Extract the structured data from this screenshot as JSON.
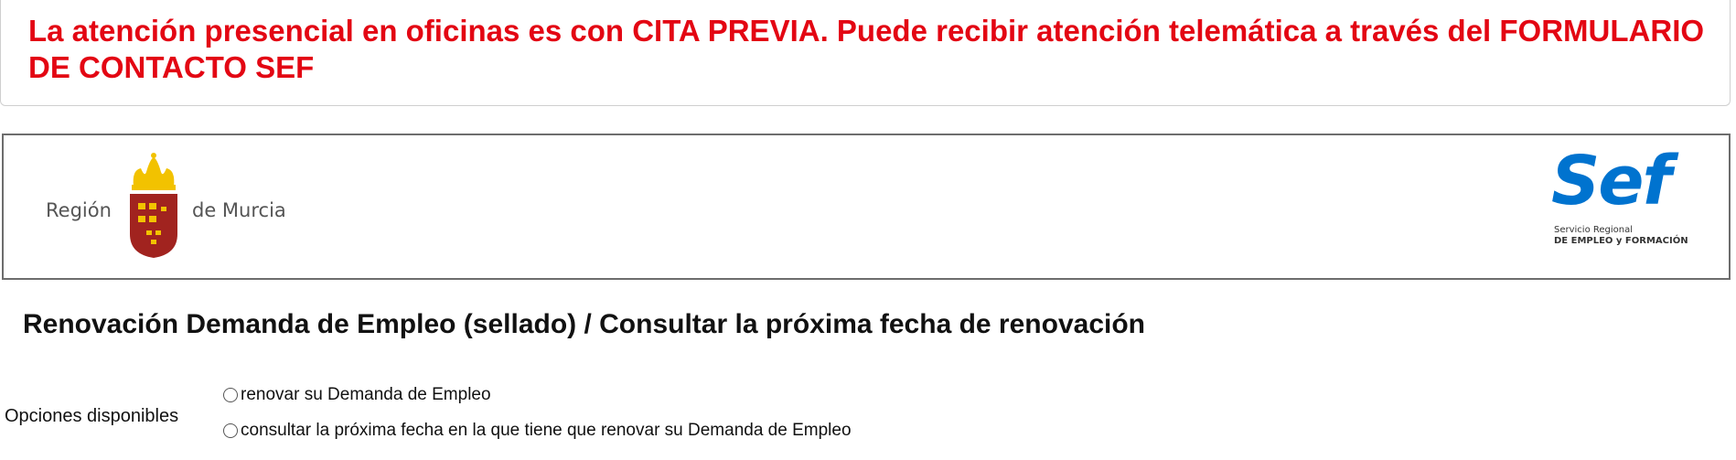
{
  "notice": {
    "text": "La atención presencial en oficinas es con CITA PREVIA. Puede recibir atención telemática a través del FORMULARIO DE CONTACTO SEF",
    "color": "#e30613"
  },
  "banner": {
    "left_logo": {
      "text_left": "Región",
      "text_right": "de Murcia",
      "icon": "crown-shield-emblem"
    },
    "right_logo": {
      "word": "Sef",
      "line1": "Servicio Regional",
      "line2": "DE EMPLEO y FORMACIÓN",
      "color": "#0073cf"
    }
  },
  "page": {
    "title": "Renovación Demanda de Empleo (sellado) / Consultar la próxima fecha de renovación"
  },
  "options": {
    "label": "Opciones disponibles",
    "items": [
      {
        "label": "renovar su Demanda de Empleo",
        "selected": false
      },
      {
        "label": "consultar la próxima fecha en la que tiene que renovar su Demanda de Empleo",
        "selected": false
      }
    ]
  }
}
